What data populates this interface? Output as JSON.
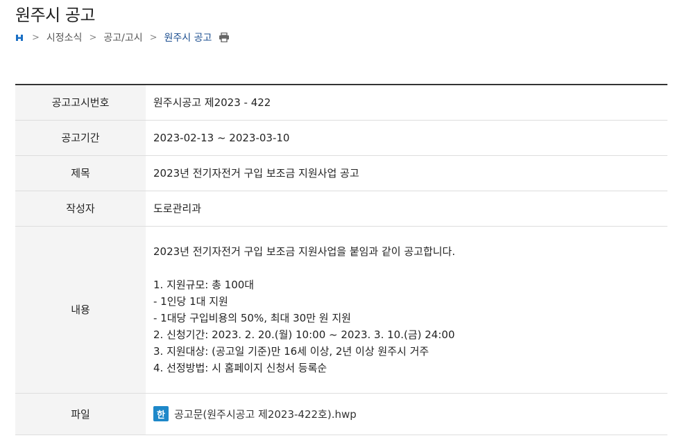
{
  "page": {
    "title": "원주시 공고"
  },
  "breadcrumb": {
    "items": [
      "시정소식",
      "공고/고시",
      "원주시 공고"
    ],
    "separator": ">"
  },
  "icons": {
    "home": "home-icon",
    "print": "print-icon",
    "file": "hwp-file-icon",
    "file_glyph": "한"
  },
  "colors": {
    "breadcrumb_current": "#1a4d8f",
    "file_icon": "#1e88c9"
  },
  "table": {
    "rows": [
      {
        "label": "공고고시번호",
        "value": "원주시공고 제2023 - 422"
      },
      {
        "label": "공고기간",
        "value": "2023-02-13 ~ 2023-03-10"
      },
      {
        "label": "제목",
        "value": "2023년 전기자전거 구입 보조금 지원사업 공고"
      },
      {
        "label": "작성자",
        "value": "도로관리과"
      },
      {
        "label": "내용"
      },
      {
        "label": "파일"
      }
    ],
    "content_lines": [
      "2023년 전기자전거 구입 보조금 지원사업을 붙임과 같이 공고합니다.",
      "",
      "1. 지원규모: 총 100대",
      "- 1인당 1대 지원",
      "- 1대당 구입비용의 50%, 최대 30만 원 지원",
      "2. 신청기간: 2023. 2. 20.(월) 10:00 ~ 2023. 3. 10.(금) 24:00",
      "3. 지원대상: (공고일 기준)만 16세 이상, 2년 이상 원주시 거주",
      "4. 선정방법: 시 홈페이지 신청서 등록순"
    ],
    "file_name": "공고문(원주시공고 제2023-422호).hwp"
  }
}
